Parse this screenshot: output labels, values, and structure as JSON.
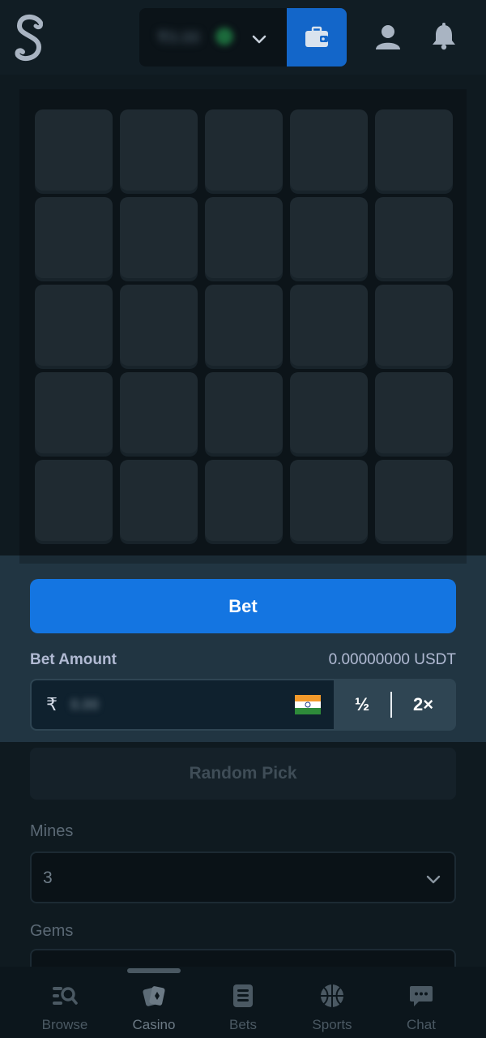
{
  "header": {
    "balance_blurred": "₹0.00",
    "wallet_label": "wallet"
  },
  "game": {
    "tiles_count": 25
  },
  "bet_panel": {
    "bet_button_label": "Bet",
    "amount_label": "Bet Amount",
    "amount_crypto": "0.00000000 USDT",
    "currency_symbol": "₹",
    "amount_value_blurred": "0.00",
    "half_label": "½",
    "double_label": "2×"
  },
  "controls": {
    "random_pick_label": "Random Pick",
    "mines_label": "Mines",
    "mines_value": "3",
    "gems_label": "Gems"
  },
  "bottom_nav": {
    "items": [
      {
        "label": "Browse",
        "icon": "browse-search-icon"
      },
      {
        "label": "Casino",
        "icon": "cards-icon"
      },
      {
        "label": "Bets",
        "icon": "betslip-icon"
      },
      {
        "label": "Sports",
        "icon": "basketball-icon"
      },
      {
        "label": "Chat",
        "icon": "chat-icon"
      }
    ],
    "active": "Casino"
  },
  "colors": {
    "accent_blue": "#1475e1",
    "panel_highlight": "#213542",
    "background": "#0f1a20"
  }
}
